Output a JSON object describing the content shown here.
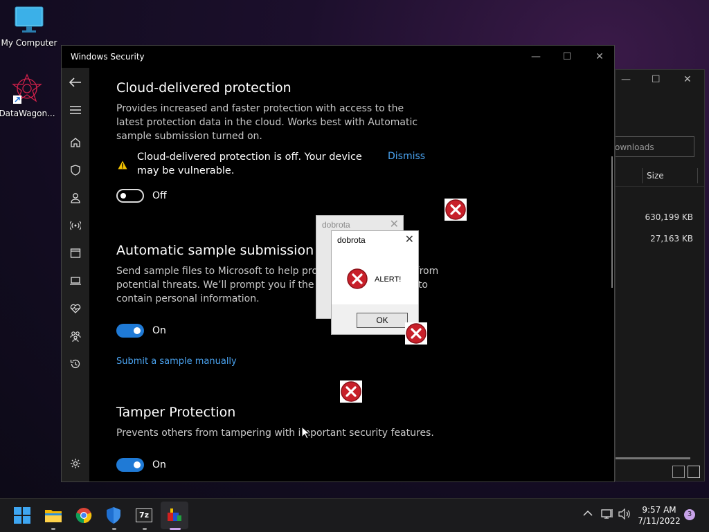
{
  "desktop": {
    "icons": [
      {
        "label": "My Computer",
        "icon": "monitor-icon"
      },
      {
        "label": "DataWagon...",
        "icon": "datawagon-icon"
      }
    ]
  },
  "explorer": {
    "address": "ownloads",
    "column_header": "Size",
    "sizes": [
      "630,199 KB",
      "27,163 KB"
    ]
  },
  "security": {
    "window_title": "Windows Security",
    "sections": {
      "cloud": {
        "title": "Cloud-delivered protection",
        "description": "Provides increased and faster protection with access to the latest protection data in the cloud. Works best with Automatic sample submission turned on.",
        "warning": "Cloud-delivered protection is off. Your device may be vulnerable.",
        "dismiss": "Dismiss",
        "toggle_label": "Off"
      },
      "sample": {
        "title": "Automatic sample submission",
        "description": "Send sample files to Microsoft to help protect you and others from potential threats. We’ll prompt you if the file we need is likely to contain personal information.",
        "toggle_label": "On",
        "link": "Submit a sample manually"
      },
      "tamper": {
        "title": "Tamper Protection",
        "description": "Prevents others from tampering with important security features.",
        "toggle_label": "On"
      }
    }
  },
  "dialogs": {
    "back_title": "dobrota",
    "front_title": "dobrota",
    "message": "ALERT!",
    "ok": "OK"
  },
  "taskbar": {
    "time": "9:57 AM",
    "date": "7/11/2022",
    "notifications": "3"
  }
}
